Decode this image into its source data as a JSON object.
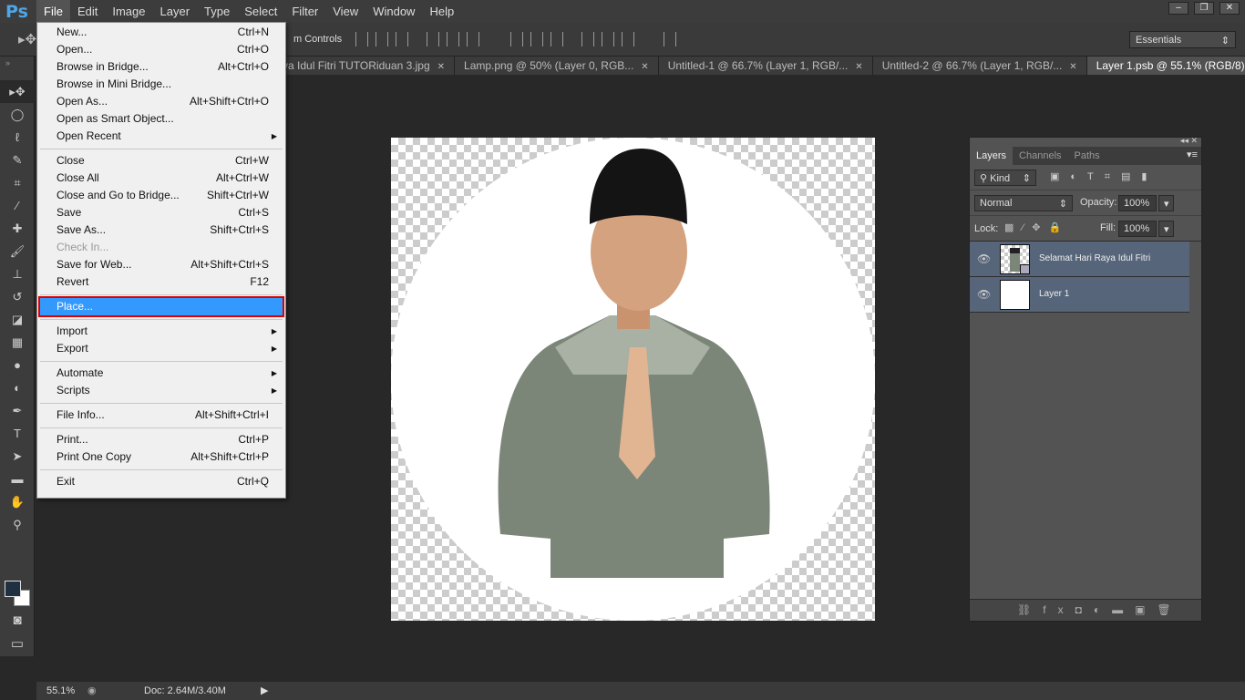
{
  "app": {
    "logo": "Ps"
  },
  "menubar": [
    "File",
    "Edit",
    "Image",
    "Layer",
    "Type",
    "Select",
    "Filter",
    "View",
    "Window",
    "Help"
  ],
  "window_buttons": [
    "minimize-icon",
    "restore-icon",
    "close-icon"
  ],
  "options": {
    "transform_label": "m Controls",
    "workspace": "Essentials"
  },
  "tabs": [
    {
      "label": "ya Idul Fitri TUTORiduan 3.jpg",
      "active": false
    },
    {
      "label": "Lamp.png @ 50% (Layer 0, RGB...",
      "active": false
    },
    {
      "label": "Untitled-1 @ 66.7% (Layer 1, RGB/...",
      "active": false
    },
    {
      "label": "Untitled-2 @ 66.7% (Layer 1, RGB/...",
      "active": false
    },
    {
      "label": "Layer 1.psb @ 55.1% (RGB/8) *",
      "active": true
    }
  ],
  "file_menu": [
    [
      {
        "label": "New...",
        "shortcut": "Ctrl+N"
      },
      {
        "label": "Open...",
        "shortcut": "Ctrl+O"
      },
      {
        "label": "Browse in Bridge...",
        "shortcut": "Alt+Ctrl+O"
      },
      {
        "label": "Browse in Mini Bridge...",
        "shortcut": ""
      },
      {
        "label": "Open As...",
        "shortcut": "Alt+Shift+Ctrl+O"
      },
      {
        "label": "Open as Smart Object...",
        "shortcut": ""
      },
      {
        "label": "Open Recent",
        "shortcut": "",
        "submenu": true
      }
    ],
    [
      {
        "label": "Close",
        "shortcut": "Ctrl+W"
      },
      {
        "label": "Close All",
        "shortcut": "Alt+Ctrl+W"
      },
      {
        "label": "Close and Go to Bridge...",
        "shortcut": "Shift+Ctrl+W"
      },
      {
        "label": "Save",
        "shortcut": "Ctrl+S"
      },
      {
        "label": "Save As...",
        "shortcut": "Shift+Ctrl+S"
      },
      {
        "label": "Check In...",
        "shortcut": "",
        "disabled": true
      },
      {
        "label": "Save for Web...",
        "shortcut": "Alt+Shift+Ctrl+S"
      },
      {
        "label": "Revert",
        "shortcut": "F12"
      }
    ],
    [
      {
        "label": "Place...",
        "shortcut": "",
        "highlighted": true
      }
    ],
    [
      {
        "label": "Import",
        "shortcut": "",
        "submenu": true
      },
      {
        "label": "Export",
        "shortcut": "",
        "submenu": true
      }
    ],
    [
      {
        "label": "Automate",
        "shortcut": "",
        "submenu": true
      },
      {
        "label": "Scripts",
        "shortcut": "",
        "submenu": true
      }
    ],
    [
      {
        "label": "File Info...",
        "shortcut": "Alt+Shift+Ctrl+I"
      }
    ],
    [
      {
        "label": "Print...",
        "shortcut": "Ctrl+P"
      },
      {
        "label": "Print One Copy",
        "shortcut": "Alt+Shift+Ctrl+P"
      }
    ],
    [
      {
        "label": "Exit",
        "shortcut": "Ctrl+Q"
      }
    ]
  ],
  "tools": [
    "move-icon",
    "marquee-icon",
    "lasso-icon",
    "quick-select-icon",
    "crop-icon",
    "eyedropper-icon",
    "healing-icon",
    "brush-icon",
    "stamp-icon",
    "history-brush-icon",
    "eraser-icon",
    "gradient-icon",
    "blur-icon",
    "dodge-icon",
    "pen-icon",
    "type-icon",
    "path-select-icon",
    "rectangle-icon",
    "hand-icon",
    "zoom-icon"
  ],
  "status": {
    "zoom": "55.1%",
    "doc": "Doc: 2.64M/3.40M"
  },
  "layers_panel": {
    "tabs": [
      "Layers",
      "Channels",
      "Paths"
    ],
    "filter": "Kind",
    "blend_mode": "Normal",
    "opacity_label": "Opacity:",
    "opacity": "100%",
    "lock_label": "Lock:",
    "fill_label": "Fill:",
    "fill": "100%",
    "layers": [
      {
        "name": "Selamat Hari Raya Idul Fitri",
        "visible": true,
        "smart_object": true
      },
      {
        "name": "Layer 1",
        "visible": true
      }
    ]
  },
  "colors": {
    "highlight": "#3399ff",
    "callout": "#dd0000",
    "layer_selected": "#56657a"
  }
}
